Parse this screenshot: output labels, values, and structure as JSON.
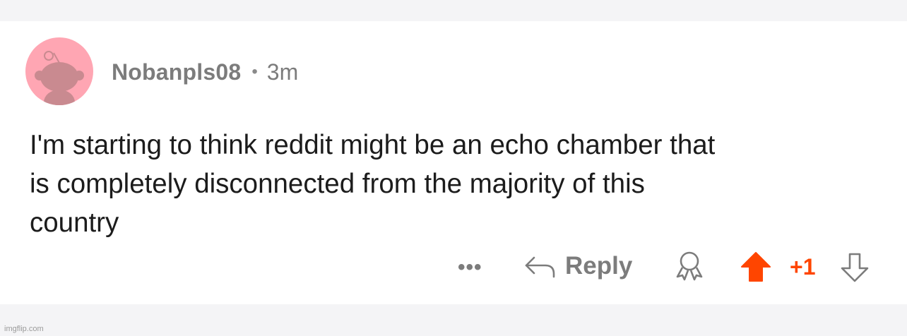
{
  "comment": {
    "username": "Nobanpls08",
    "separator": "•",
    "timestamp": "3m",
    "body_lines": [
      "I'm starting to think reddit might be an echo chamber that",
      "is completely disconnected from the majority of this",
      "country"
    ]
  },
  "actions": {
    "more_label": "•••",
    "reply_label": "Reply",
    "score": "+1",
    "upvote_state": "upvoted"
  },
  "icons": {
    "avatar": "snoo-avatar-icon",
    "reply": "reply-arrow-icon",
    "award": "award-icon",
    "upvote": "upvote-arrow-icon",
    "downvote": "downvote-arrow-icon"
  },
  "colors": {
    "avatar_background": "#ffa6b3",
    "avatar_figure": "#c98a90",
    "upvote_active": "#ff4500",
    "muted_text": "#7c7c7c",
    "body_text": "#1c1c1c"
  },
  "watermark": "imgflip.com"
}
